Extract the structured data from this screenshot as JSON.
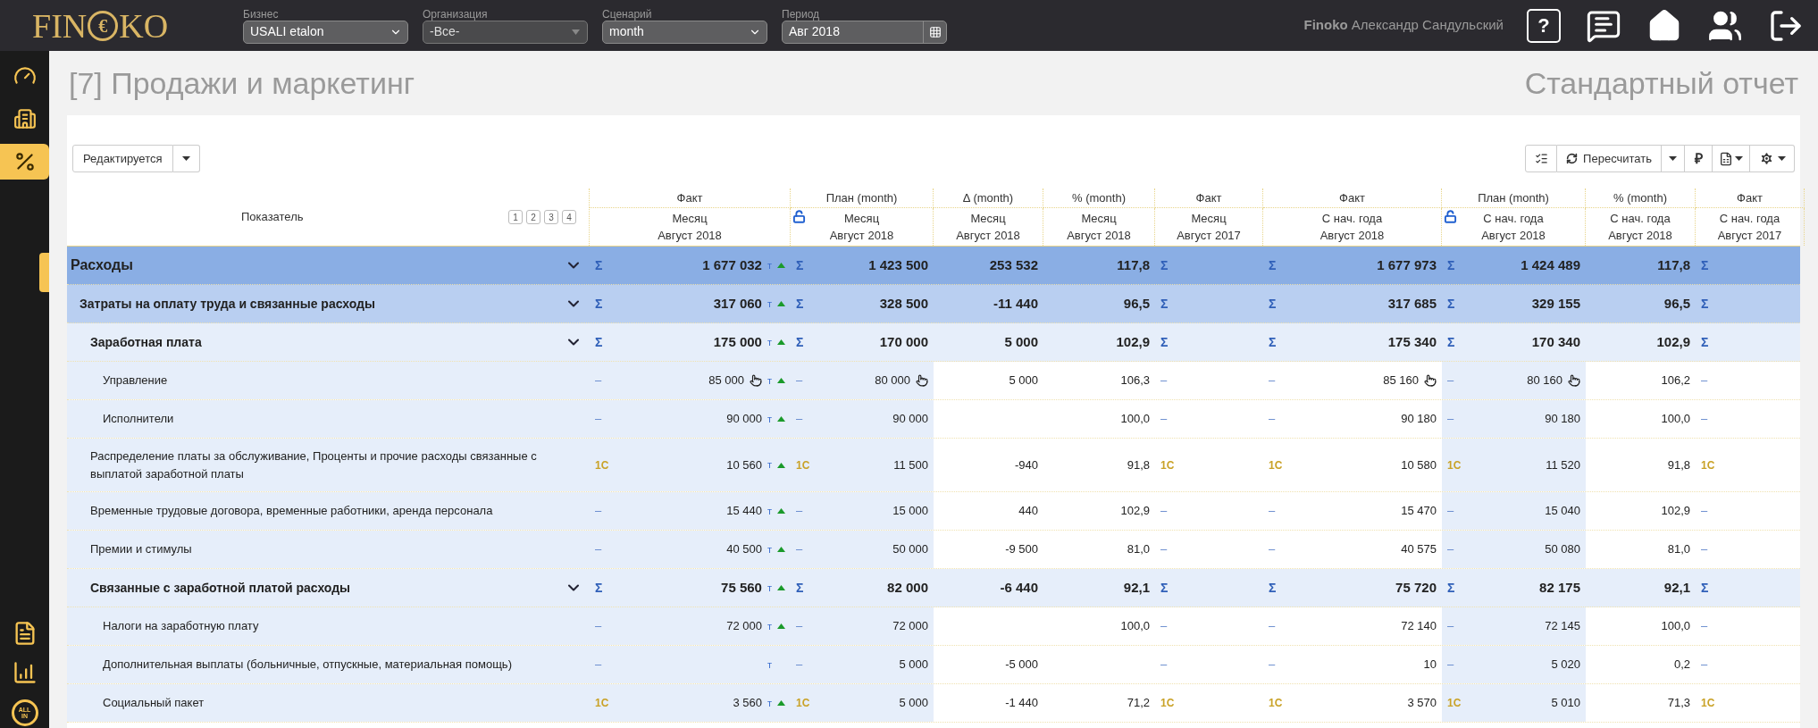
{
  "topbar": {
    "logo": {
      "left": "FIN",
      "mark": "€",
      "right": "KO"
    },
    "selects": [
      {
        "label": "Бизнес",
        "value": "USALI etalon",
        "disabled": false,
        "kind": "select"
      },
      {
        "label": "Организация",
        "value": "-Все-",
        "disabled": true,
        "kind": "select"
      },
      {
        "label": "Сценарий",
        "value": "month",
        "disabled": false,
        "kind": "select"
      },
      {
        "label": "Период",
        "value": "Авг 2018",
        "disabled": false,
        "kind": "date"
      }
    ],
    "user": {
      "company": "Finoko",
      "name": "Александр Сандульский"
    },
    "help": "?"
  },
  "sidebar": {
    "items": [
      {
        "selected": false
      },
      {
        "selected": false
      },
      {
        "selected": true
      }
    ],
    "bottom_badge": [
      "ALL",
      "IN"
    ]
  },
  "page": {
    "title": "[7] Продажи и маркетинг",
    "report": "Стандартный отчет"
  },
  "toolbar": {
    "status": "Редактируется",
    "recalc": "Пересчитать",
    "currency": "₽"
  },
  "table": {
    "first_header": "Показатель",
    "levels": [
      "1",
      "2",
      "3",
      "4"
    ],
    "columns": [
      {
        "group": "Факт",
        "period": "Месяц",
        "date": "Август 2018",
        "kind": "input"
      },
      {
        "group": "План (month)",
        "period": "Месяц",
        "date": "Август 2018",
        "kind": "input",
        "locked": false
      },
      {
        "group": "Δ (month)",
        "period": "Месяц",
        "date": "Август 2018",
        "kind": "calc"
      },
      {
        "group": "% (month)",
        "period": "Месяц",
        "date": "Август 2018",
        "kind": "calc"
      },
      {
        "group": "Факт",
        "period": "Месяц",
        "date": "Август 2017",
        "kind": "calc"
      },
      {
        "group": "Факт",
        "period": "С нач. года",
        "date": "Август 2018",
        "kind": "calc"
      },
      {
        "group": "План (month)",
        "period": "С нач. года",
        "date": "Август 2018",
        "kind": "input",
        "locked": false
      },
      {
        "group": "% (month)",
        "period": "С нач. года",
        "date": "Август 2018",
        "kind": "calc"
      },
      {
        "group": "Факт",
        "period": "С нач. года",
        "date": "Август 2017",
        "kind": "calc"
      }
    ],
    "rows": [
      {
        "label": "Расходы",
        "expanded": true,
        "cells": [
          {
            "marker": "Σ",
            "value": "1 677 032",
            "flag": "т",
            "trend_up": true
          },
          {
            "marker": "Σ",
            "value": "1 423 500"
          },
          {
            "value": "253 532"
          },
          {
            "value": "117,8"
          },
          {
            "marker": "Σ"
          },
          {
            "marker": "Σ",
            "value": "1 677 973"
          },
          {
            "marker": "Σ",
            "value": "1 424 489"
          },
          {
            "value": "117,8"
          },
          {
            "marker": "Σ"
          }
        ],
        "children": [
          {
            "label": "Затраты на оплату труда и связанные расходы",
            "expanded": true,
            "cells": [
              {
                "marker": "Σ",
                "value": "317 060",
                "flag": "т",
                "trend_up": true
              },
              {
                "marker": "Σ",
                "value": "328 500"
              },
              {
                "value": "-11 440"
              },
              {
                "value": "96,5"
              },
              {
                "marker": "Σ"
              },
              {
                "marker": "Σ",
                "value": "317 685"
              },
              {
                "marker": "Σ",
                "value": "329 155"
              },
              {
                "value": "96,5"
              },
              {
                "marker": "Σ"
              }
            ],
            "children": [
              {
                "label": "Заработная плата",
                "expanded": true,
                "cells": [
                  {
                    "marker": "Σ",
                    "value": "175 000",
                    "flag": "т",
                    "trend_up": true
                  },
                  {
                    "marker": "Σ",
                    "value": "170 000"
                  },
                  {
                    "value": "5 000"
                  },
                  {
                    "value": "102,9"
                  },
                  {
                    "marker": "Σ"
                  },
                  {
                    "marker": "Σ",
                    "value": "175 340"
                  },
                  {
                    "marker": "Σ",
                    "value": "170 340"
                  },
                  {
                    "value": "102,9"
                  },
                  {
                    "marker": "Σ"
                  }
                ],
                "children": [
                  {
                    "label": "Управление",
                    "cells": [
                      {
                        "marker": "–",
                        "value": "85 000",
                        "hand": true,
                        "flag": "т",
                        "trend_up": true
                      },
                      {
                        "marker": "–",
                        "value": "80 000",
                        "hand": true
                      },
                      {
                        "value": "5 000"
                      },
                      {
                        "value": "106,3"
                      },
                      {
                        "marker": "–"
                      },
                      {
                        "marker": "–",
                        "value": "85 160",
                        "hand": true
                      },
                      {
                        "marker": "–",
                        "value": "80 160",
                        "hand": true
                      },
                      {
                        "value": "106,2"
                      },
                      {
                        "marker": "–"
                      }
                    ]
                  },
                  {
                    "label": "Исполнители",
                    "cells": [
                      {
                        "marker": "–",
                        "value": "90 000",
                        "flag": "т",
                        "trend_up": true
                      },
                      {
                        "marker": "–",
                        "value": "90 000"
                      },
                      null,
                      {
                        "value": "100,0"
                      },
                      {
                        "marker": "–"
                      },
                      {
                        "marker": "–",
                        "value": "90 180"
                      },
                      {
                        "marker": "–",
                        "value": "90 180"
                      },
                      {
                        "value": "100,0"
                      },
                      {
                        "marker": "–"
                      }
                    ]
                  }
                ]
              },
              {
                "label": "Распределение платы за обслуживание, Проценты и прочие расходы связанные с выплатой заработной платы",
                "cells": [
                  {
                    "marker": "1С",
                    "value": "10 560",
                    "flag": "т",
                    "trend_up": true
                  },
                  {
                    "marker": "1С",
                    "value": "11 500"
                  },
                  {
                    "value": "-940"
                  },
                  {
                    "value": "91,8"
                  },
                  {
                    "marker": "1С"
                  },
                  {
                    "marker": "1С",
                    "value": "10 580"
                  },
                  {
                    "marker": "1С",
                    "value": "11 520"
                  },
                  {
                    "value": "91,8"
                  },
                  {
                    "marker": "1С"
                  }
                ]
              },
              {
                "label": "Временные трудовые договора, временные работники, аренда персонала",
                "cells": [
                  {
                    "marker": "–",
                    "value": "15 440",
                    "flag": "т",
                    "trend_up": true
                  },
                  {
                    "marker": "–",
                    "value": "15 000"
                  },
                  {
                    "value": "440"
                  },
                  {
                    "value": "102,9"
                  },
                  {
                    "marker": "–"
                  },
                  {
                    "marker": "–",
                    "value": "15 470"
                  },
                  {
                    "marker": "–",
                    "value": "15 040"
                  },
                  {
                    "value": "102,9"
                  },
                  {
                    "marker": "–"
                  }
                ]
              },
              {
                "label": "Премии и стимулы",
                "cells": [
                  {
                    "marker": "–",
                    "value": "40 500",
                    "flag": "т",
                    "trend_up": true
                  },
                  {
                    "marker": "–",
                    "value": "50 000"
                  },
                  {
                    "value": "-9 500"
                  },
                  {
                    "value": "81,0"
                  },
                  {
                    "marker": "–"
                  },
                  {
                    "marker": "–",
                    "value": "40 575"
                  },
                  {
                    "marker": "–",
                    "value": "50 080"
                  },
                  {
                    "value": "81,0"
                  },
                  {
                    "marker": "–"
                  }
                ]
              },
              {
                "label": "Связанные с заработной платой расходы",
                "expanded": true,
                "cells": [
                  {
                    "marker": "Σ",
                    "value": "75 560",
                    "flag": "т",
                    "trend_up": true
                  },
                  {
                    "marker": "Σ",
                    "value": "82 000"
                  },
                  {
                    "value": "-6 440"
                  },
                  {
                    "value": "92,1"
                  },
                  {
                    "marker": "Σ"
                  },
                  {
                    "marker": "Σ",
                    "value": "75 720"
                  },
                  {
                    "marker": "Σ",
                    "value": "82 175"
                  },
                  {
                    "value": "92,1"
                  },
                  {
                    "marker": "Σ"
                  }
                ],
                "children": [
                  {
                    "label": "Налоги на заработную плату",
                    "cells": [
                      {
                        "marker": "–",
                        "value": "72 000",
                        "flag": "т",
                        "trend_up": true
                      },
                      {
                        "marker": "–",
                        "value": "72 000"
                      },
                      null,
                      {
                        "value": "100,0"
                      },
                      {
                        "marker": "–"
                      },
                      {
                        "marker": "–",
                        "value": "72 140"
                      },
                      {
                        "marker": "–",
                        "value": "72 145"
                      },
                      {
                        "value": "100,0"
                      },
                      {
                        "marker": "–"
                      }
                    ]
                  },
                  {
                    "label": "Дополнительная выплаты (больничные, отпускные, материальная помощь)",
                    "cells": [
                      {
                        "marker": "–",
                        "flag": "т"
                      },
                      {
                        "marker": "–",
                        "value": "5 000"
                      },
                      {
                        "value": "-5 000"
                      },
                      null,
                      {
                        "marker": "–"
                      },
                      {
                        "marker": "–",
                        "value": "10"
                      },
                      {
                        "marker": "–",
                        "value": "5 020"
                      },
                      {
                        "value": "0,2"
                      },
                      {
                        "marker": "–"
                      }
                    ]
                  },
                  {
                    "label": "Социальный пакет",
                    "cells": [
                      {
                        "marker": "1С",
                        "value": "3 560",
                        "flag": "т",
                        "trend_up": true
                      },
                      {
                        "marker": "1С",
                        "value": "5 000"
                      },
                      {
                        "value": "-1 440"
                      },
                      {
                        "value": "71,2"
                      },
                      {
                        "marker": "1С"
                      },
                      {
                        "marker": "1С",
                        "value": "3 570"
                      },
                      {
                        "marker": "1С",
                        "value": "5 010"
                      },
                      {
                        "value": "71,3"
                      },
                      {
                        "marker": "1С"
                      }
                    ]
                  }
                ]
              }
            ]
          }
        ]
      }
    ]
  }
}
